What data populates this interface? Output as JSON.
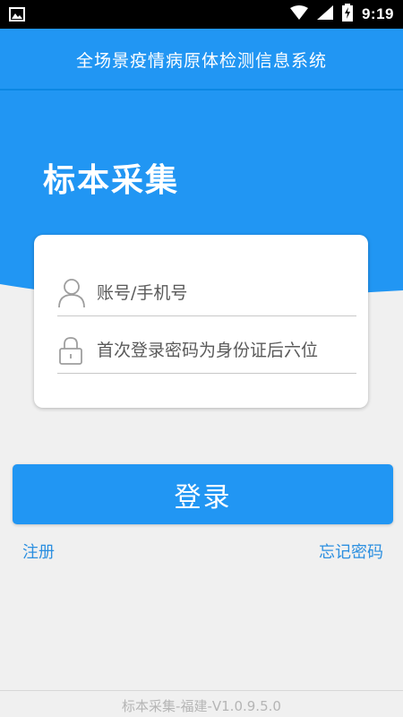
{
  "status_bar": {
    "time": "9:19"
  },
  "header": {
    "app_title": "全场景疫情病原体检测信息系统"
  },
  "page": {
    "heading": "标本采集"
  },
  "login_form": {
    "account": {
      "value": "",
      "placeholder": "账号/手机号"
    },
    "password": {
      "value": "",
      "placeholder": "首次登录密码为身份证后六位"
    }
  },
  "actions": {
    "login_label": "登录",
    "register_label": "注册",
    "forgot_label": "忘记密码"
  },
  "footer": {
    "version_text": "标本采集-福建-V1.0.9.5.0"
  },
  "colors": {
    "primary": "#2196f3",
    "link": "#2b8fe0",
    "background": "#f0f0f0"
  }
}
